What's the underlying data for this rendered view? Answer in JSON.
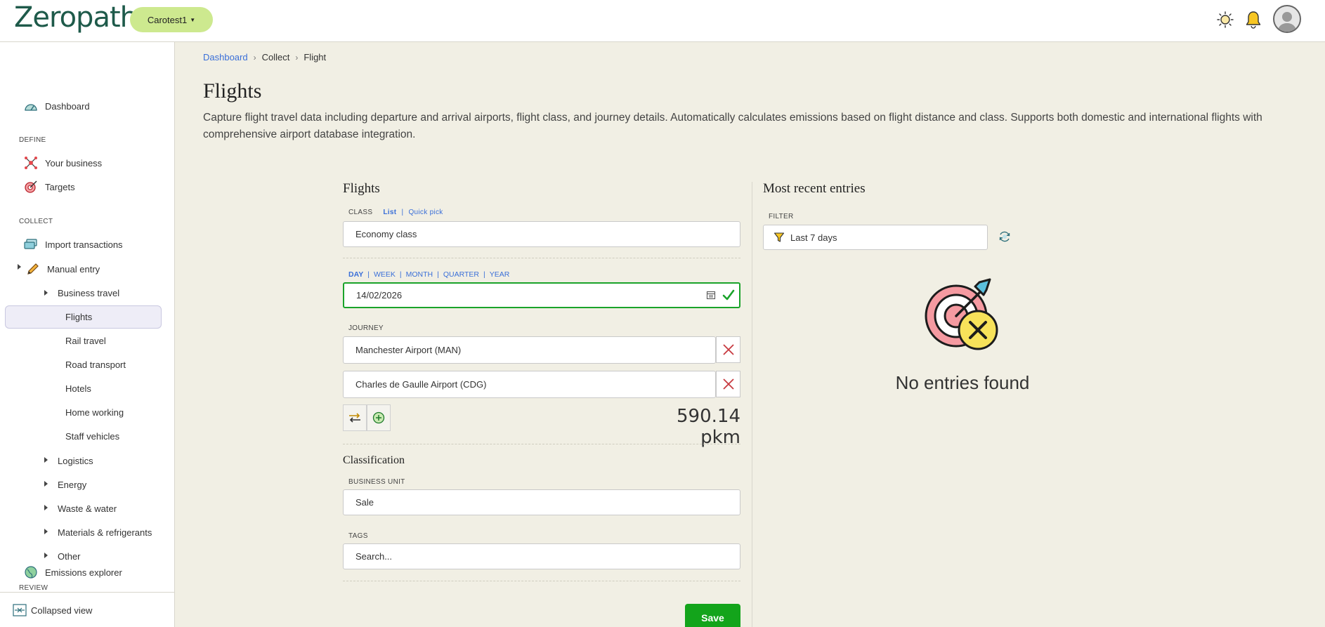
{
  "app": {
    "logo": "Zeropath",
    "org_selector": "Carotest1"
  },
  "sidebar": {
    "dashboard": "Dashboard",
    "define_heading": "DEFINE",
    "your_business": "Your business",
    "targets": "Targets",
    "collect_heading": "COLLECT",
    "import_transactions": "Import transactions",
    "manual_entry": "Manual entry",
    "business_travel": "Business travel",
    "flights": "Flights",
    "rail_travel": "Rail travel",
    "road_transport": "Road transport",
    "hotels": "Hotels",
    "home_working": "Home working",
    "staff_vehicles": "Staff vehicles",
    "logistics": "Logistics",
    "energy": "Energy",
    "waste_water": "Waste & water",
    "materials_refrigerants": "Materials & refrigerants",
    "other": "Other",
    "review_heading": "REVIEW",
    "emissions_explorer": "Emissions explorer",
    "collapsed_view": "Collapsed view"
  },
  "breadcrumb": {
    "dashboard": "Dashboard",
    "collect": "Collect",
    "current": "Flight",
    "separator": "›"
  },
  "page": {
    "title": "Flights",
    "description": "Capture flight travel data including departure and arrival airports, flight class, and journey details. Automatically calculates emissions based on flight distance and class. Supports both domestic and international flights with comprehensive airport database integration."
  },
  "form": {
    "title": "Flights",
    "class_label": "CLASS",
    "class_mode_list": "List",
    "class_mode_sep": "|",
    "class_mode_quick": "Quick pick",
    "class_value": "Economy class",
    "period": {
      "day": "DAY",
      "week": "WEEK",
      "month": "MONTH",
      "quarter": "QUARTER",
      "year": "YEAR",
      "sep": "|"
    },
    "date_value": "14/02/2026",
    "journey_label": "JOURNEY",
    "from_airport": "Manchester Airport (MAN)",
    "to_airport": "Charles de Gaulle Airport (CDG)",
    "distance": "590.14 pkm",
    "classification_title": "Classification",
    "business_unit_label": "BUSINESS UNIT",
    "business_unit_value": "Sale",
    "tags_label": "TAGS",
    "tags_placeholder": "Search...",
    "save": "Save"
  },
  "recent": {
    "title": "Most recent entries",
    "filter_label": "FILTER",
    "filter_value": "Last 7 days",
    "empty_message": "No entries found"
  },
  "colors": {
    "accent_blue": "#3a6fd8",
    "save_green": "#13a41b",
    "valid_green": "#1aa32a",
    "org_pill": "#cde98f",
    "page_bg": "#f1efe4"
  }
}
